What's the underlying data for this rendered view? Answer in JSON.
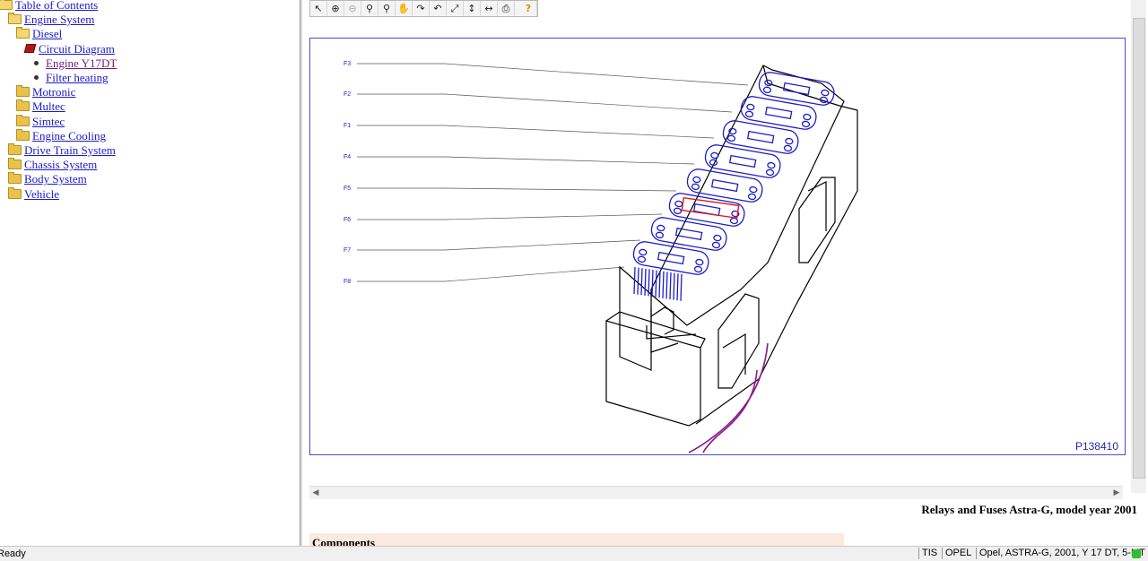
{
  "tree": {
    "items": [
      {
        "label": "Table of Contents",
        "level": 0,
        "icon": "folder-open-icon"
      },
      {
        "label": "Engine System",
        "level": 1,
        "icon": "folder-open-icon"
      },
      {
        "label": "Diesel",
        "level": 2,
        "icon": "folder-open-icon"
      },
      {
        "label": "Circuit Diagram",
        "level": 3,
        "icon": "book-icon"
      },
      {
        "label": "Engine Y17DT",
        "level": 4,
        "icon": "bullet-icon",
        "visited": true
      },
      {
        "label": "Filter heating",
        "level": 4,
        "icon": "bullet-icon"
      },
      {
        "label": "Motronic",
        "level": 2,
        "icon": "folder-icon"
      },
      {
        "label": "Multec",
        "level": 2,
        "icon": "folder-icon"
      },
      {
        "label": "Simtec",
        "level": 2,
        "icon": "folder-icon"
      },
      {
        "label": "Engine Cooling",
        "level": 2,
        "icon": "folder-icon"
      },
      {
        "label": "Drive Train System",
        "level": 1,
        "icon": "folder-icon"
      },
      {
        "label": "Chassis System",
        "level": 1,
        "icon": "folder-icon"
      },
      {
        "label": "Body System",
        "level": 1,
        "icon": "folder-icon"
      },
      {
        "label": "Vehicle",
        "level": 1,
        "icon": "folder-icon"
      }
    ]
  },
  "toolbar": {
    "tools": [
      {
        "name": "select-arrow-icon",
        "glyph": "↖"
      },
      {
        "name": "zoom-in-icon",
        "glyph": "⊕"
      },
      {
        "name": "zoom-out-icon",
        "glyph": "⊖",
        "disabled": true
      },
      {
        "name": "zoom-icon",
        "glyph": "⚲"
      },
      {
        "name": "zoom-area-icon",
        "glyph": "⚲"
      },
      {
        "name": "pan-hand-icon",
        "glyph": "✋",
        "disabled": true
      },
      {
        "name": "rotate-cw-icon",
        "glyph": "↷"
      },
      {
        "name": "rotate-ccw-icon",
        "glyph": "↶"
      },
      {
        "name": "fit-page-icon",
        "glyph": "⤢"
      },
      {
        "name": "fit-height-icon",
        "glyph": "↕"
      },
      {
        "name": "fit-width-icon",
        "glyph": "↔"
      },
      {
        "name": "print-icon",
        "glyph": "⎙"
      },
      {
        "name": "help-icon",
        "glyph": "?"
      }
    ]
  },
  "diagram": {
    "fuse_labels": [
      "F3",
      "F2",
      "F1",
      "F4",
      "F5",
      "F6",
      "F7",
      "F8"
    ],
    "figure_id": "P138410",
    "line_color": "#1c1ccc",
    "highlight_color": "#e01818",
    "wire_color": "#8a1a8a"
  },
  "caption": "Relays and Fuses Astra-G, model year 2001",
  "components_heading": "Components",
  "status": {
    "ready": "Ready",
    "cells": [
      "TIS",
      "OPEL",
      "Opel, ASTRA-G, 2001, Y 17 DT, 5-MT"
    ]
  }
}
